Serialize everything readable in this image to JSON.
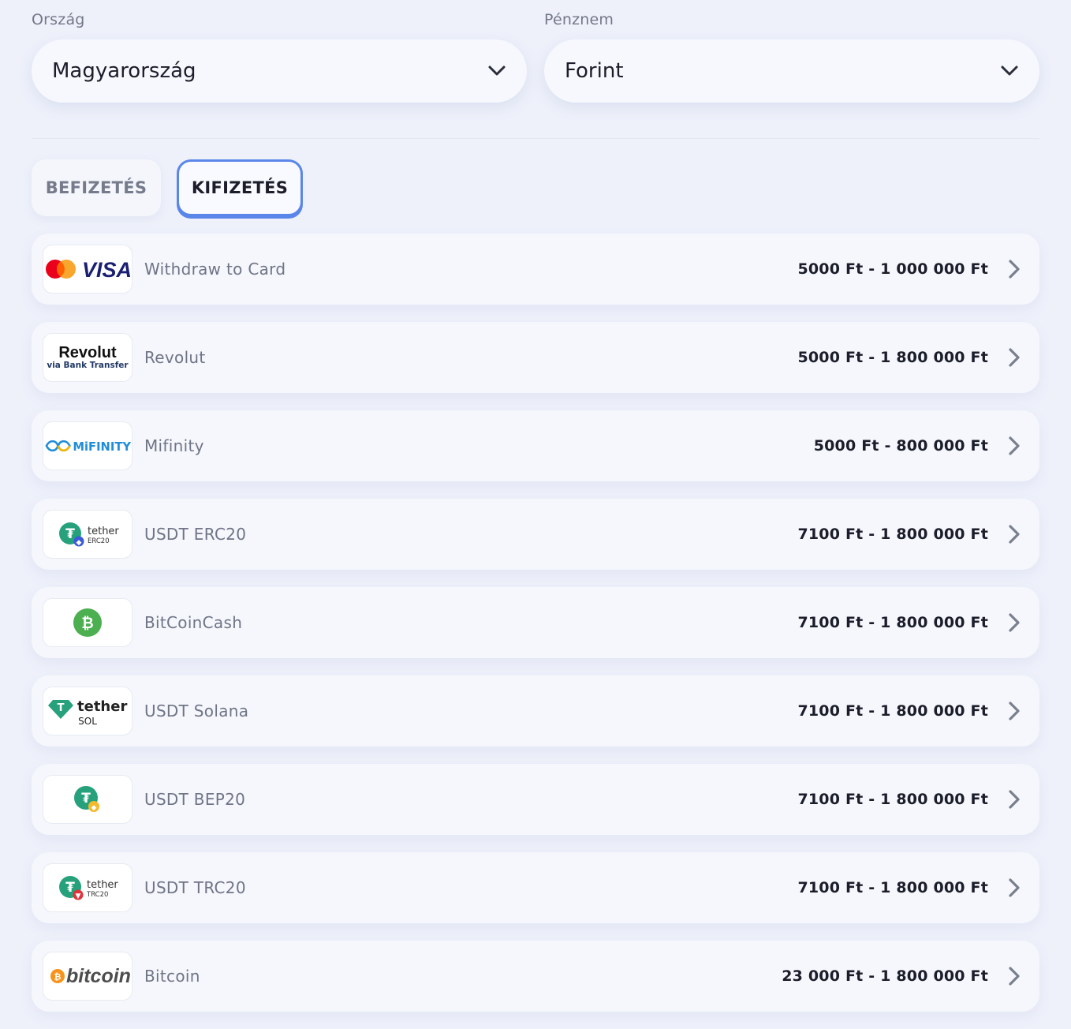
{
  "country": {
    "label": "Ország",
    "value": "Magyarország"
  },
  "currency": {
    "label": "Pénznem",
    "value": "Forint"
  },
  "tabs": [
    {
      "label": "BEFIZETÉS",
      "active": false
    },
    {
      "label": "KIFIZETÉS",
      "active": true
    }
  ],
  "methods": [
    {
      "name": "Withdraw to Card",
      "range": "5000 Ft - 1 000 000 Ft",
      "icon": "mastercard-visa-logo",
      "logo_text": "VISA"
    },
    {
      "name": "Revolut",
      "range": "5000 Ft - 1 800 000 Ft",
      "icon": "revolut-logo",
      "logo_text": "Revolut",
      "logo_sub": "via Bank Transfer"
    },
    {
      "name": "Mifinity",
      "range": "5000 Ft - 800 000 Ft",
      "icon": "mifinity-logo",
      "logo_text": "MiFINITY"
    },
    {
      "name": "USDT ERC20",
      "range": "7100 Ft - 1 800 000 Ft",
      "icon": "tether-erc20-logo",
      "logo_text": "tether",
      "logo_sub": "ERC20"
    },
    {
      "name": "BitCoinCash",
      "range": "7100 Ft - 1 800 000 Ft",
      "icon": "bitcoin-cash-logo"
    },
    {
      "name": "USDT Solana",
      "range": "7100 Ft - 1 800 000 Ft",
      "icon": "tether-sol-logo",
      "logo_text": "tether",
      "logo_sub": "SOL"
    },
    {
      "name": "USDT BEP20",
      "range": "7100 Ft - 1 800 000 Ft",
      "icon": "tether-bep20-logo"
    },
    {
      "name": "USDT TRC20",
      "range": "7100 Ft - 1 800 000 Ft",
      "icon": "tether-trc20-logo",
      "logo_text": "tether",
      "logo_sub": "TRC20"
    },
    {
      "name": "Bitcoin",
      "range": "23 000 Ft - 1 800 000 Ft",
      "icon": "bitcoin-logo",
      "logo_text": "bitcoin"
    }
  ],
  "colors": {
    "background": "#eef1fa",
    "accent": "#5a86ea",
    "tether": "#26a17b",
    "bitcoin_cash": "#4caf50",
    "bitcoin": "#f7931a",
    "visa": "#1a1f71"
  }
}
